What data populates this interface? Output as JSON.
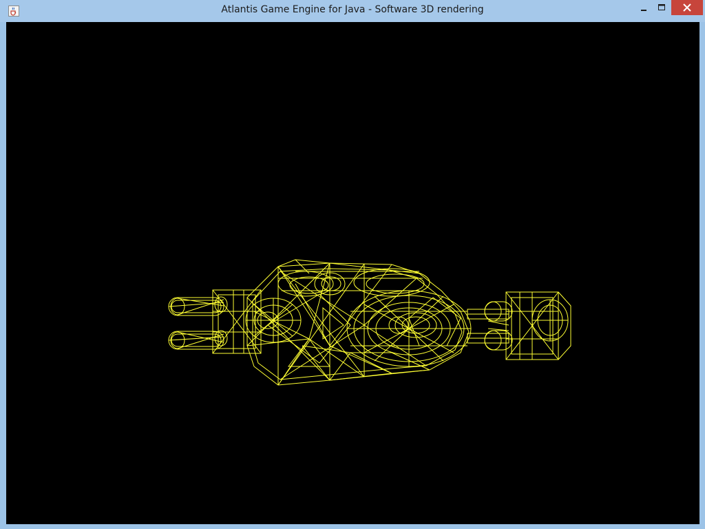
{
  "window": {
    "title": "Atlantis Game Engine for Java - Software 3D rendering",
    "app_icon": "java-coffee-cup-icon",
    "controls": [
      "minimize-icon",
      "maximize-icon",
      "close-icon"
    ]
  },
  "viewport": {
    "background": "#000000",
    "wireframe_color": "#ffff33",
    "render_mode": "wireframe"
  },
  "colors": {
    "titlebar": "#a5c8ea",
    "frame": "#9cc3e7",
    "close": "#c7453b"
  }
}
